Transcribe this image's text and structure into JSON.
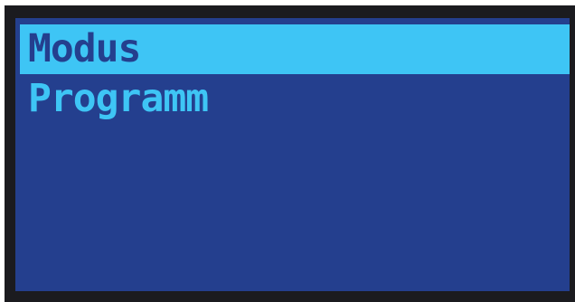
{
  "menu": {
    "items": [
      {
        "label": "Modus",
        "selected": true
      },
      {
        "label": "Programm",
        "selected": false
      }
    ]
  },
  "colors": {
    "screen_background": "#243f8e",
    "highlight": "#3ec5f5",
    "bezel": "#1b1b1f"
  }
}
